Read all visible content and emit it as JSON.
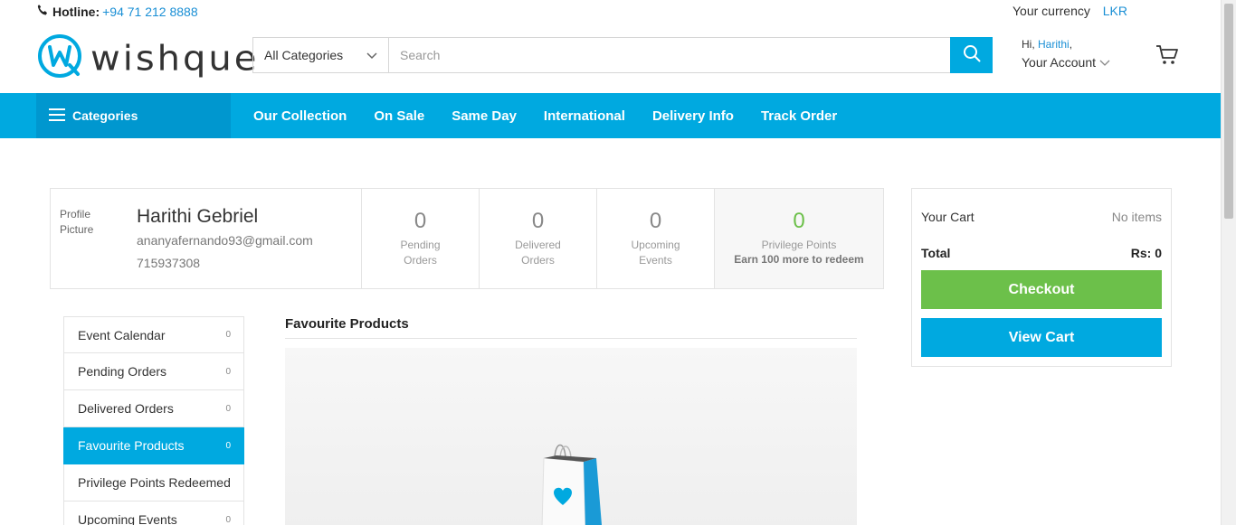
{
  "topbar": {
    "hotline_label": "Hotline:",
    "hotline_number": "+94 71 212 8888",
    "currency_label": "Your currency",
    "currency_value": "LKR"
  },
  "logo": {
    "text": "wishque"
  },
  "search": {
    "category": "All Categories",
    "placeholder": "Search",
    "value": ""
  },
  "account": {
    "greeting": "Hi,",
    "username": "Harithi",
    "comma": ",",
    "label": "Your Account"
  },
  "nav": {
    "categories_label": "Categories",
    "links": [
      "Our Collection",
      "On Sale",
      "Same Day",
      "International",
      "Delivery Info",
      "Track Order"
    ]
  },
  "profile": {
    "picture_alt": "Profile Picture",
    "name": "Harithi Gebriel",
    "email": "ananyafernando93@gmail.com",
    "phone": "715937308",
    "stats": [
      {
        "value": "0",
        "line1": "Pending",
        "line2": "Orders"
      },
      {
        "value": "0",
        "line1": "Delivered",
        "line2": "Orders"
      },
      {
        "value": "0",
        "line1": "Upcoming",
        "line2": "Events"
      }
    ],
    "privilege": {
      "value": "0",
      "label": "Privilege Points",
      "sub": "Earn 100 more to redeem"
    }
  },
  "cart": {
    "title": "Your Cart",
    "status": "No items",
    "total_label": "Total",
    "total_value": "Rs: 0",
    "checkout": "Checkout",
    "view_cart": "View Cart"
  },
  "sidemenu": {
    "items": [
      {
        "label": "Event Calendar",
        "count": "0"
      },
      {
        "label": "Pending Orders",
        "count": "0"
      },
      {
        "label": "Delivered Orders",
        "count": "0"
      },
      {
        "label": "Favourite Products",
        "count": "0",
        "active": true
      },
      {
        "label": "Privilege Points Redeemed",
        "count": ""
      },
      {
        "label": "Upcoming Events",
        "count": "0"
      }
    ]
  },
  "favourites": {
    "title": "Favourite Products"
  },
  "colors": {
    "accent": "#00a9e0",
    "accent_dark": "#0097cf",
    "green": "#6cc04a",
    "link": "#1a8fd5"
  }
}
